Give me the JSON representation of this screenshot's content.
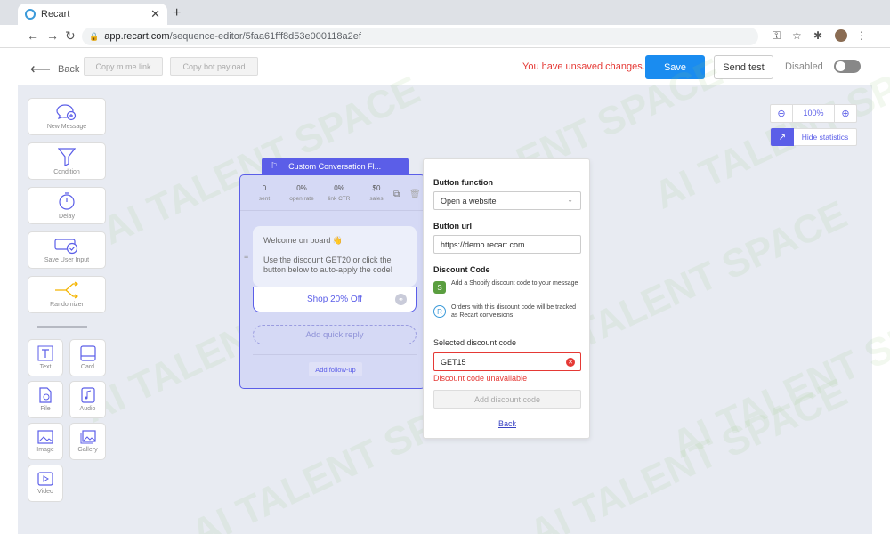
{
  "browser": {
    "tab_title": "Recart",
    "tab_close": "✕",
    "new_tab": "+",
    "url_domain": "app.recart.com",
    "url_path": "/sequence-editor/5faa61fff8d53e000118a2ef"
  },
  "header": {
    "back_label": "Back",
    "copy_link_label": "Copy m.me link",
    "copy_payload_label": "Copy bot payload",
    "unsaved_text": "You have unsaved changes.",
    "save_label": "Save",
    "send_test_label": "Send test",
    "status_label": "Disabled"
  },
  "sidebar": {
    "items": [
      {
        "label": "New Message",
        "icon": "new-message-icon"
      },
      {
        "label": "Condition",
        "icon": "filter-icon"
      },
      {
        "label": "Delay",
        "icon": "timer-icon"
      },
      {
        "label": "Save User Input",
        "icon": "save-input-icon"
      },
      {
        "label": "Randomizer",
        "icon": "randomizer-icon"
      }
    ],
    "blocks": [
      {
        "label": "Text",
        "icon": "text-icon"
      },
      {
        "label": "Card",
        "icon": "card-icon"
      },
      {
        "label": "File",
        "icon": "file-icon"
      },
      {
        "label": "Audio",
        "icon": "audio-icon"
      },
      {
        "label": "Image",
        "icon": "image-icon"
      },
      {
        "label": "Gallery",
        "icon": "gallery-icon"
      },
      {
        "label": "Video",
        "icon": "video-icon"
      }
    ]
  },
  "node": {
    "title": "Custom Conversation Fl...",
    "stats": [
      {
        "value": "0",
        "label": "sent"
      },
      {
        "value": "0%",
        "label": "open rate"
      },
      {
        "value": "0%",
        "label": "link CTR"
      },
      {
        "value": "$0",
        "label": "sales"
      }
    ],
    "welcome": "Welcome on board 👋",
    "body": "Use the discount GET20 or click the button below to auto-apply the code!",
    "button_label": "Shop 20% Off",
    "quick_reply_label": "Add quick reply",
    "follow_up_label": "Add follow-up"
  },
  "panel": {
    "function_label": "Button function",
    "function_value": "Open a website",
    "url_label": "Button url",
    "url_value": "https://demo.recart.com",
    "discount_label": "Discount Code",
    "info1": "Add a Shopify discount code to your message",
    "info2": "Orders with this discount code will be tracked as Recart conversions",
    "selected_label": "Selected discount code",
    "selected_value": "GET15",
    "error_text": "Discount code unavailable",
    "add_code_label": "Add discount code",
    "back_label": "Back"
  },
  "zoom": {
    "level": "100%",
    "hide_stats_label": "Hide statistics"
  },
  "watermark": "AI TALENT SPACE",
  "colors": {
    "accent": "#5b5ee8",
    "save": "#1a8cf0",
    "error": "#e53935"
  }
}
